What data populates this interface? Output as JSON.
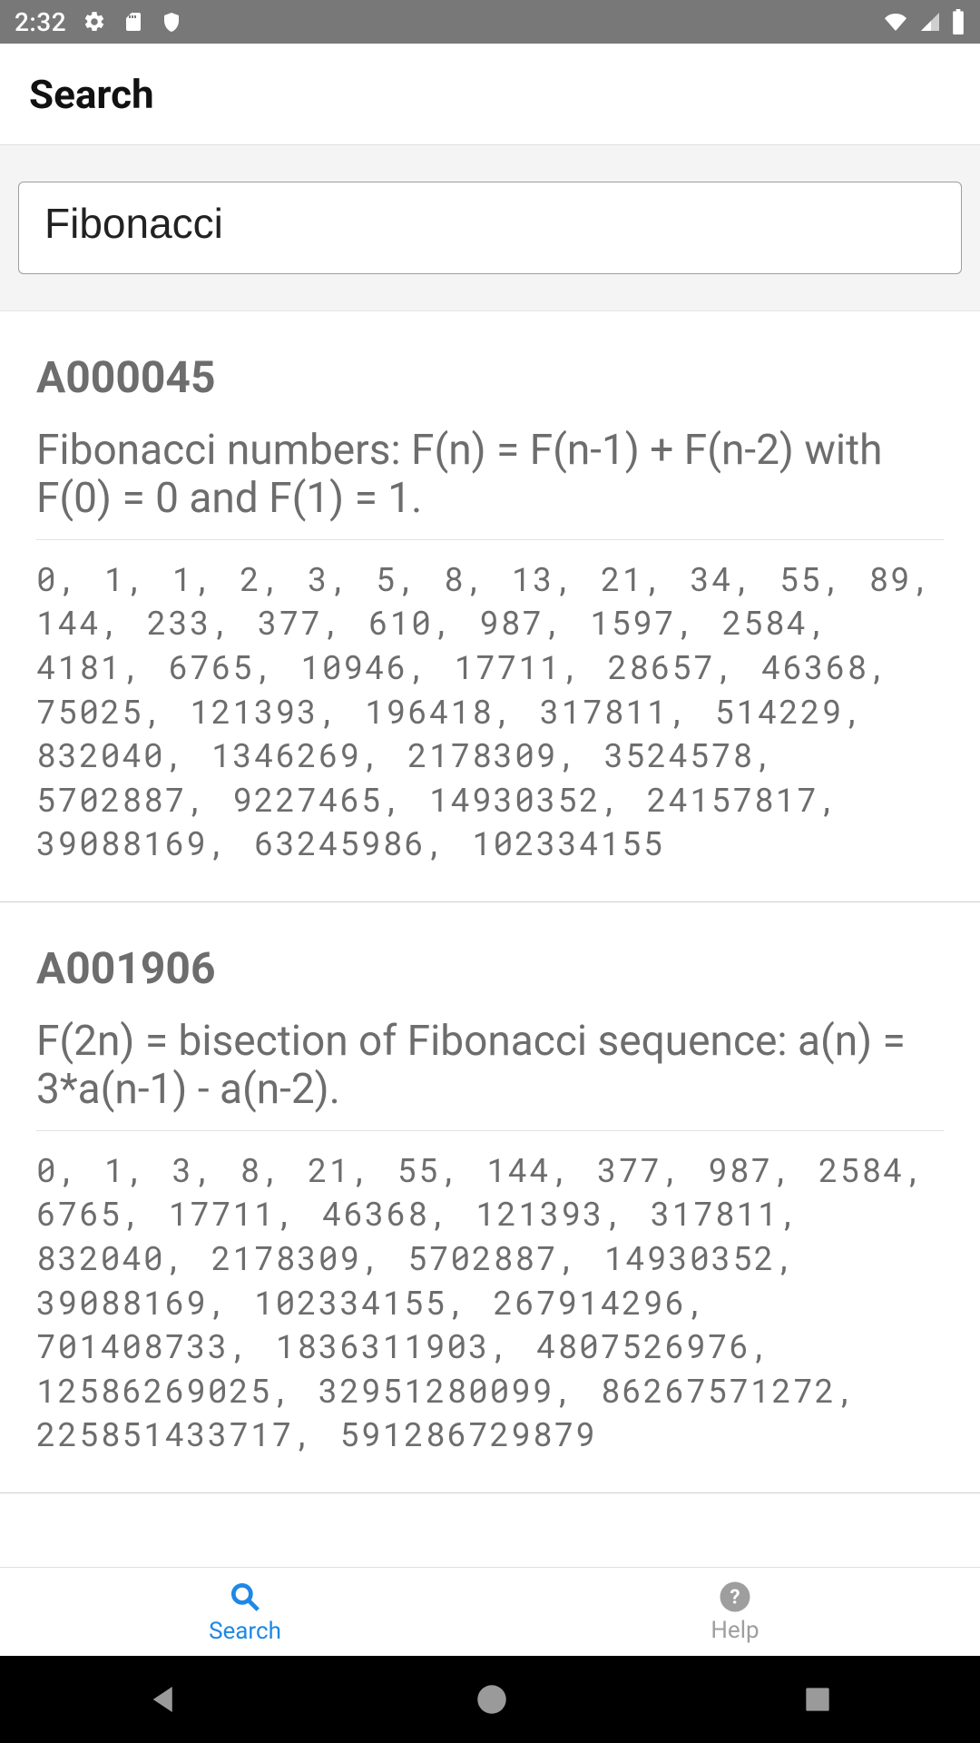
{
  "status": {
    "time": "2:32",
    "icons_left": [
      "gear-icon",
      "sd-card-icon",
      "shield-icon"
    ],
    "icons_right": [
      "wifi-icon",
      "cell-icon",
      "battery-charging-icon"
    ]
  },
  "header": {
    "title": "Search"
  },
  "search": {
    "value": "Fibonacci"
  },
  "results": [
    {
      "id": "A000045",
      "description": "Fibonacci numbers: F(n) = F(n-1) + F(n-2) with F(0) = 0 and F(1) = 1.",
      "sequence": "0, 1, 1, 2, 3, 5, 8, 13, 21, 34, 55, 89, 144, 233, 377, 610, 987, 1597, 2584, 4181, 6765, 10946, 17711, 28657, 46368, 75025, 121393, 196418, 317811, 514229, 832040, 1346269, 2178309, 3524578, 5702887, 9227465, 14930352, 24157817, 39088169, 63245986, 102334155"
    },
    {
      "id": "A001906",
      "description": "F(2n) = bisection of Fibonacci sequence: a(n) = 3*a(n-1) - a(n-2).",
      "sequence": "0, 1, 3, 8, 21, 55, 144, 377, 987, 2584, 6765, 17711, 46368, 121393, 317811, 832040, 2178309, 5702887, 14930352, 39088169, 102334155, 267914296, 701408733, 1836311903, 4807526976, 12586269025, 32951280099, 86267571272, 225851433717, 591286729879"
    }
  ],
  "tabs": [
    {
      "label": "Search",
      "icon": "search-icon",
      "active": true
    },
    {
      "label": "Help",
      "icon": "help-icon",
      "active": false
    }
  ],
  "nav": [
    "back-icon",
    "home-icon",
    "recent-icon"
  ]
}
